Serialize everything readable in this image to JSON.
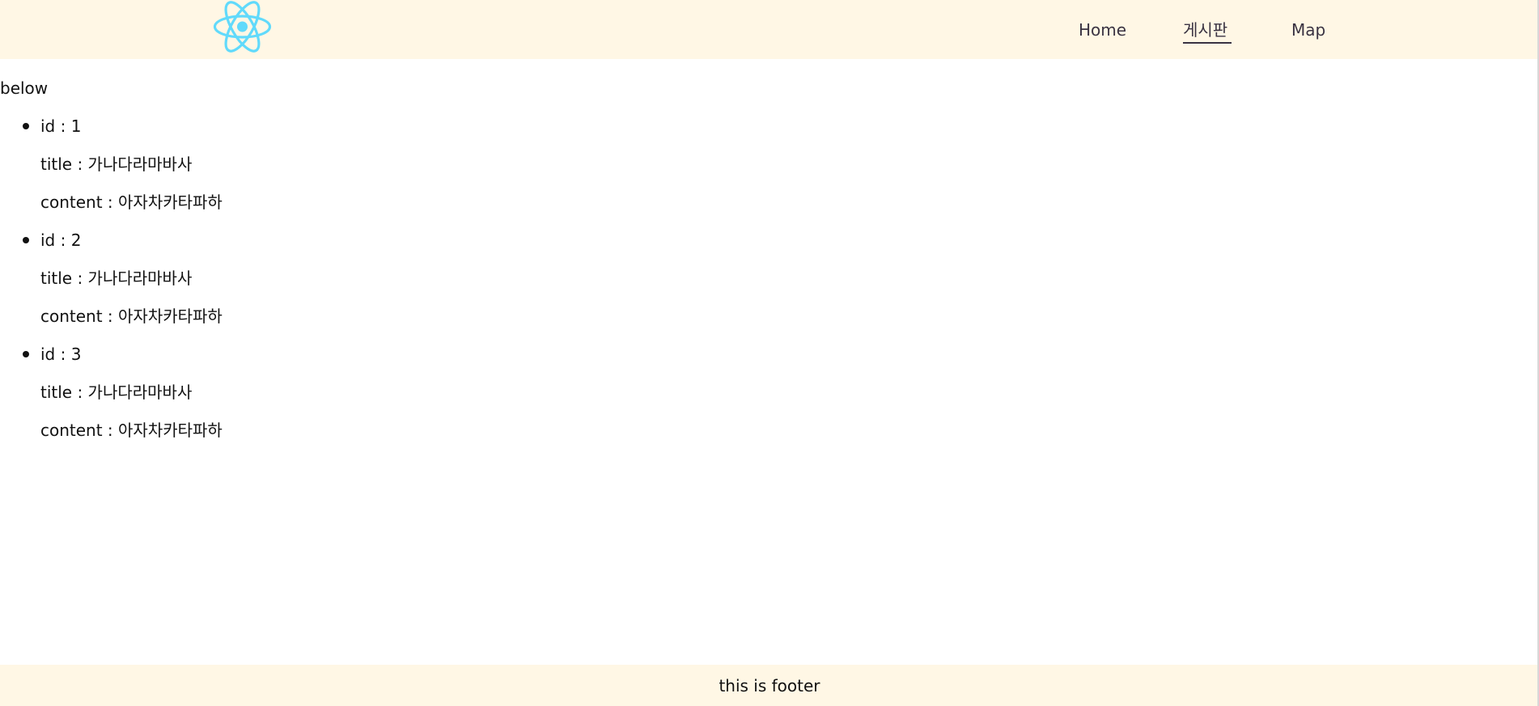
{
  "header": {
    "logo_icon": "react-logo-icon",
    "logo_color": "#61dafb",
    "nav": [
      {
        "label": "Home"
      },
      {
        "label": "게시판",
        "active": true
      },
      {
        "label": "Map"
      }
    ]
  },
  "main": {
    "below_text": "below",
    "posts": [
      {
        "id_line": "id : 1",
        "title_line": "title : 가나다라마바사",
        "content_line": "content : 아자차카타파하"
      },
      {
        "id_line": "id : 2",
        "title_line": "title : 가나다라마바사",
        "content_line": "content : 아자차카타파하"
      },
      {
        "id_line": "id : 3",
        "title_line": "title : 가나다라마바사",
        "content_line": "content : 아자차카타파하"
      }
    ]
  },
  "footer": {
    "text": "this is footer"
  },
  "colors": {
    "header_bg": "#fff7e5",
    "footer_bg": "#fff7e5",
    "nav_text": "#3a3342"
  }
}
